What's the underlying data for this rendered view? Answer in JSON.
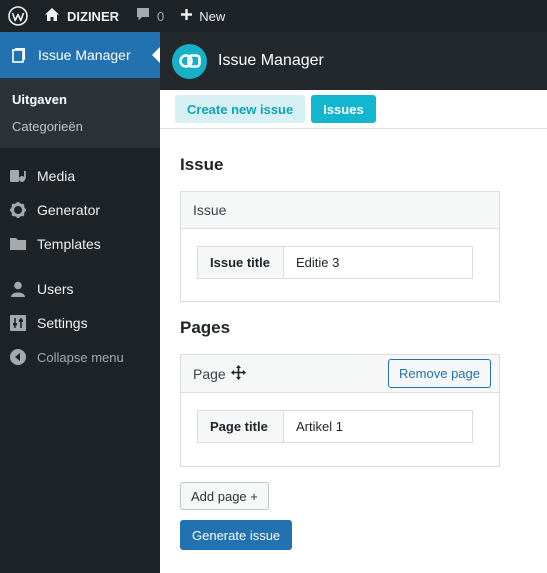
{
  "admin_bar": {
    "site_name": "DIZINER",
    "comment_count": "0",
    "new_label": "New"
  },
  "sidebar": {
    "active_menu": "Issue Manager",
    "submenu": [
      "Uitgaven",
      "Categorieën"
    ],
    "items": [
      {
        "label": "Media",
        "icon": "media-icon"
      },
      {
        "label": "Generator",
        "icon": "gear-icon"
      },
      {
        "label": "Templates",
        "icon": "folder-icon"
      },
      {
        "label": "Users",
        "icon": "user-icon"
      },
      {
        "label": "Settings",
        "icon": "settings-icon"
      },
      {
        "label": "Collapse menu",
        "icon": "collapse-icon"
      }
    ]
  },
  "header": {
    "title": "Issue Manager"
  },
  "tabs": {
    "create": "Create new issue",
    "issues": "Issues"
  },
  "issue_section": {
    "heading": "Issue",
    "panel_title": "Issue",
    "field_label": "Issue title",
    "field_value": "Editie 3"
  },
  "pages_section": {
    "heading": "Pages",
    "panel_title": "Page",
    "remove_label": "Remove page",
    "field_label": "Page title",
    "field_value": "Artikel 1"
  },
  "buttons": {
    "add_page": "Add page +",
    "generate": "Generate issue"
  },
  "colors": {
    "admin_bg": "#1d2327",
    "active_blue": "#2271b1",
    "accent_teal": "#12b6cf"
  }
}
